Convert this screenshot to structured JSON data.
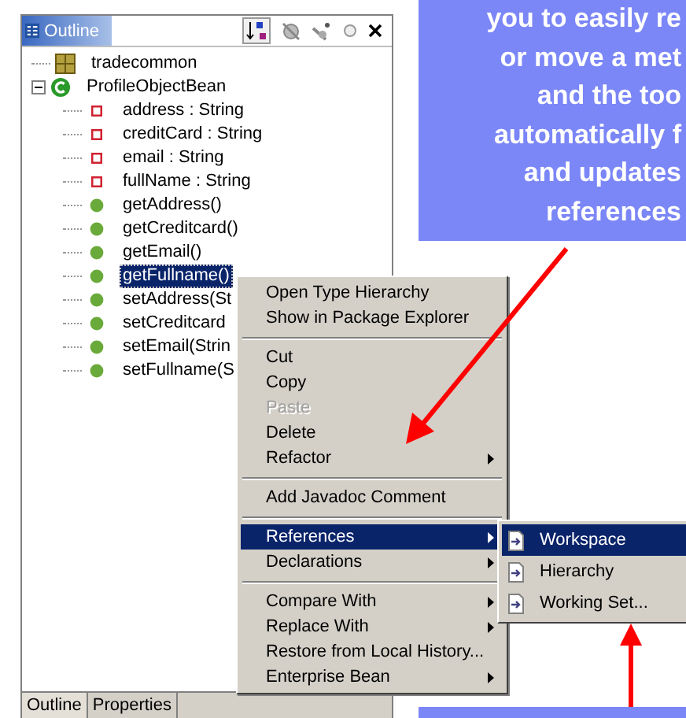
{
  "outline_panel": {
    "title": "Outline",
    "tree": [
      {
        "label": "tradecommon",
        "kind": "package",
        "selected": false
      },
      {
        "label": "ProfileObjectBean",
        "kind": "class",
        "selected": false,
        "expanded": true,
        "children": [
          {
            "label": "address : String",
            "kind": "field",
            "selected": false
          },
          {
            "label": "creditCard : String",
            "kind": "field",
            "selected": false
          },
          {
            "label": "email : String",
            "kind": "field",
            "selected": false
          },
          {
            "label": "fullName : String",
            "kind": "field",
            "selected": false
          },
          {
            "label": "getAddress()",
            "kind": "method",
            "selected": false
          },
          {
            "label": "getCreditcard()",
            "kind": "method",
            "selected": false
          },
          {
            "label": "getEmail()",
            "kind": "method",
            "selected": false
          },
          {
            "label": "getFullname()",
            "kind": "method",
            "selected": true
          },
          {
            "label": "setAddress(St",
            "kind": "method",
            "selected": false
          },
          {
            "label": "setCreditcard",
            "kind": "method",
            "selected": false
          },
          {
            "label": "setEmail(Strin",
            "kind": "method",
            "selected": false
          },
          {
            "label": "setFullname(S",
            "kind": "method",
            "selected": false
          }
        ]
      }
    ],
    "bottom_tabs": [
      {
        "label": "Outline",
        "selected": true
      },
      {
        "label": "Properties",
        "selected": false
      }
    ]
  },
  "context_menu": {
    "items": [
      {
        "kind": "item",
        "label": "Open Type Hierarchy",
        "disabled": false,
        "has_submenu": false,
        "selected": false
      },
      {
        "kind": "item",
        "label": "Show in Package Explorer",
        "disabled": false,
        "has_submenu": false,
        "selected": false
      },
      {
        "kind": "separator"
      },
      {
        "kind": "item",
        "label": "Cut",
        "disabled": false,
        "has_submenu": false,
        "selected": false
      },
      {
        "kind": "item",
        "label": "Copy",
        "disabled": false,
        "has_submenu": false,
        "selected": false
      },
      {
        "kind": "item",
        "label": "Paste",
        "disabled": true,
        "has_submenu": false,
        "selected": false
      },
      {
        "kind": "item",
        "label": "Delete",
        "disabled": false,
        "has_submenu": false,
        "selected": false
      },
      {
        "kind": "item",
        "label": "Refactor",
        "disabled": false,
        "has_submenu": true,
        "selected": false
      },
      {
        "kind": "separator"
      },
      {
        "kind": "item",
        "label": "Add Javadoc Comment",
        "disabled": false,
        "has_submenu": false,
        "selected": false
      },
      {
        "kind": "separator"
      },
      {
        "kind": "item",
        "label": "References",
        "disabled": false,
        "has_submenu": true,
        "selected": true
      },
      {
        "kind": "item",
        "label": "Declarations",
        "disabled": false,
        "has_submenu": true,
        "selected": false
      },
      {
        "kind": "separator"
      },
      {
        "kind": "item",
        "label": "Compare With",
        "disabled": false,
        "has_submenu": true,
        "selected": false
      },
      {
        "kind": "item",
        "label": "Replace With",
        "disabled": false,
        "has_submenu": true,
        "selected": false
      },
      {
        "kind": "item",
        "label": "Restore from Local History...",
        "disabled": false,
        "has_submenu": false,
        "selected": false
      },
      {
        "kind": "item",
        "label": "Enterprise Bean",
        "disabled": false,
        "has_submenu": true,
        "selected": false
      }
    ]
  },
  "submenu": {
    "items": [
      {
        "label": "Workspace",
        "selected": true
      },
      {
        "label": "Hierarchy",
        "selected": false
      },
      {
        "label": "Working Set...",
        "selected": false
      }
    ]
  },
  "callout": {
    "lines": [
      "you to easily re",
      "or move a met",
      "and the too",
      "automatically f",
      "and updates",
      "references"
    ]
  }
}
